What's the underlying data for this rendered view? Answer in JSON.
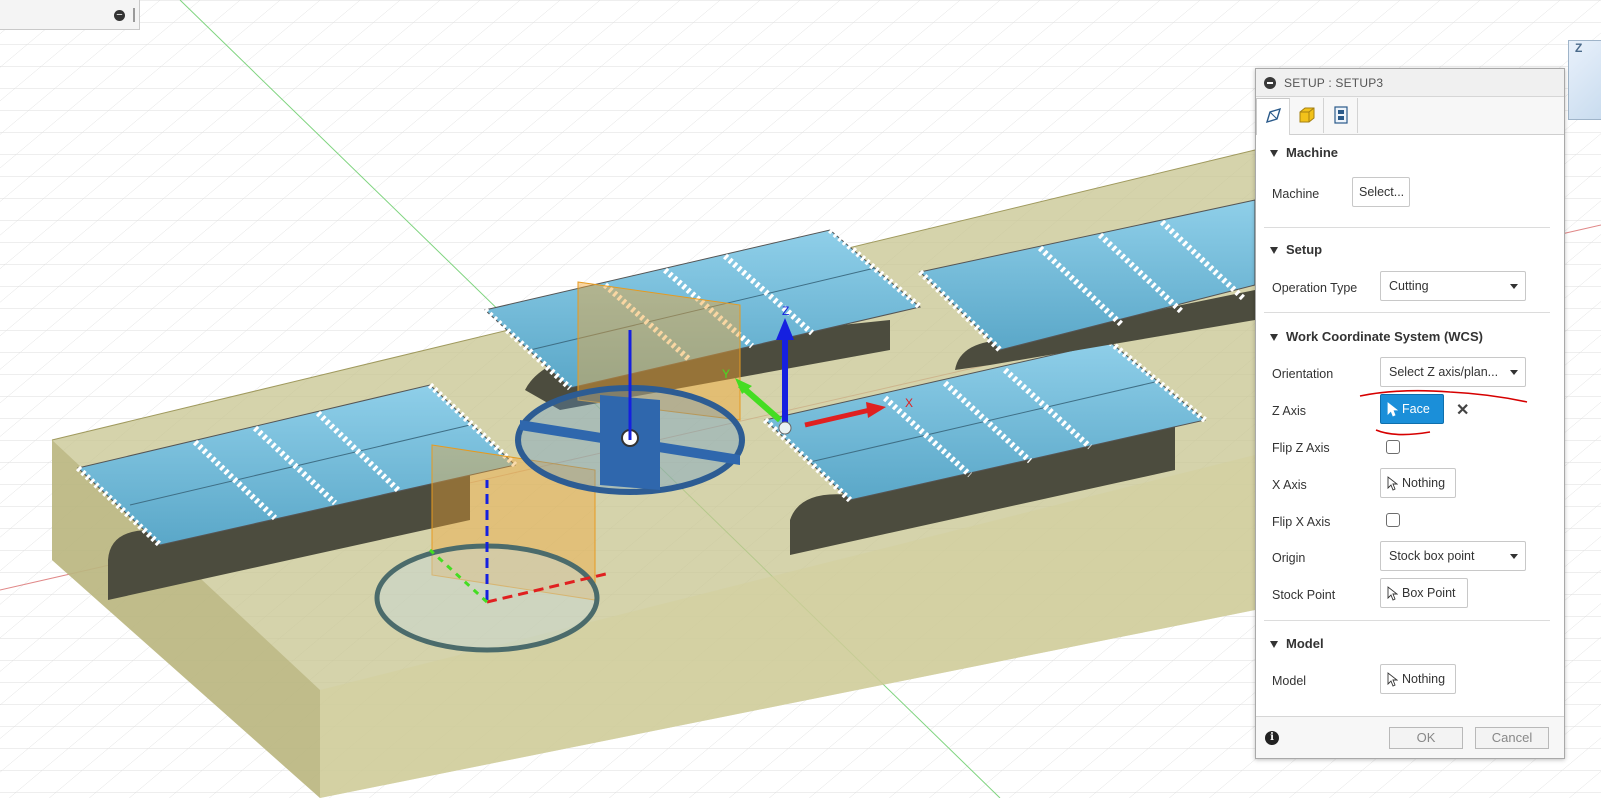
{
  "viewport": {
    "axis_labels": {
      "z": "Z",
      "x": "X",
      "y": "Y"
    },
    "view_cube_label": "Z"
  },
  "setup_panel": {
    "title": "SETUP : SETUP3",
    "tabs": [
      {
        "name": "setup-tab",
        "icon": "setup-icon"
      },
      {
        "name": "stock-tab",
        "icon": "stock-box-icon"
      },
      {
        "name": "post-process-tab",
        "icon": "post-process-icon"
      }
    ],
    "sections": {
      "machine": {
        "title": "Machine",
        "machine_label": "Machine",
        "machine_button": "Select..."
      },
      "setup": {
        "title": "Setup",
        "operation_type_label": "Operation Type",
        "operation_type_value": "Cutting"
      },
      "wcs": {
        "title": "Work Coordinate System (WCS)",
        "orientation_label": "Orientation",
        "orientation_value": "Select Z axis/plan...",
        "z_axis_label": "Z Axis",
        "z_axis_value": "Face",
        "flip_z_label": "Flip Z Axis",
        "flip_z_checked": false,
        "x_axis_label": "X Axis",
        "x_axis_value": "Nothing",
        "flip_x_label": "Flip X Axis",
        "flip_x_checked": false,
        "origin_label": "Origin",
        "origin_value": "Stock box point",
        "stock_point_label": "Stock Point",
        "stock_point_value": "Box Point"
      },
      "model": {
        "title": "Model",
        "model_label": "Model",
        "model_value": "Nothing"
      }
    },
    "footer": {
      "ok": "OK",
      "cancel": "Cancel"
    },
    "colors": {
      "selected_button": "#1b8fd9",
      "annotation": "#d60000"
    }
  }
}
